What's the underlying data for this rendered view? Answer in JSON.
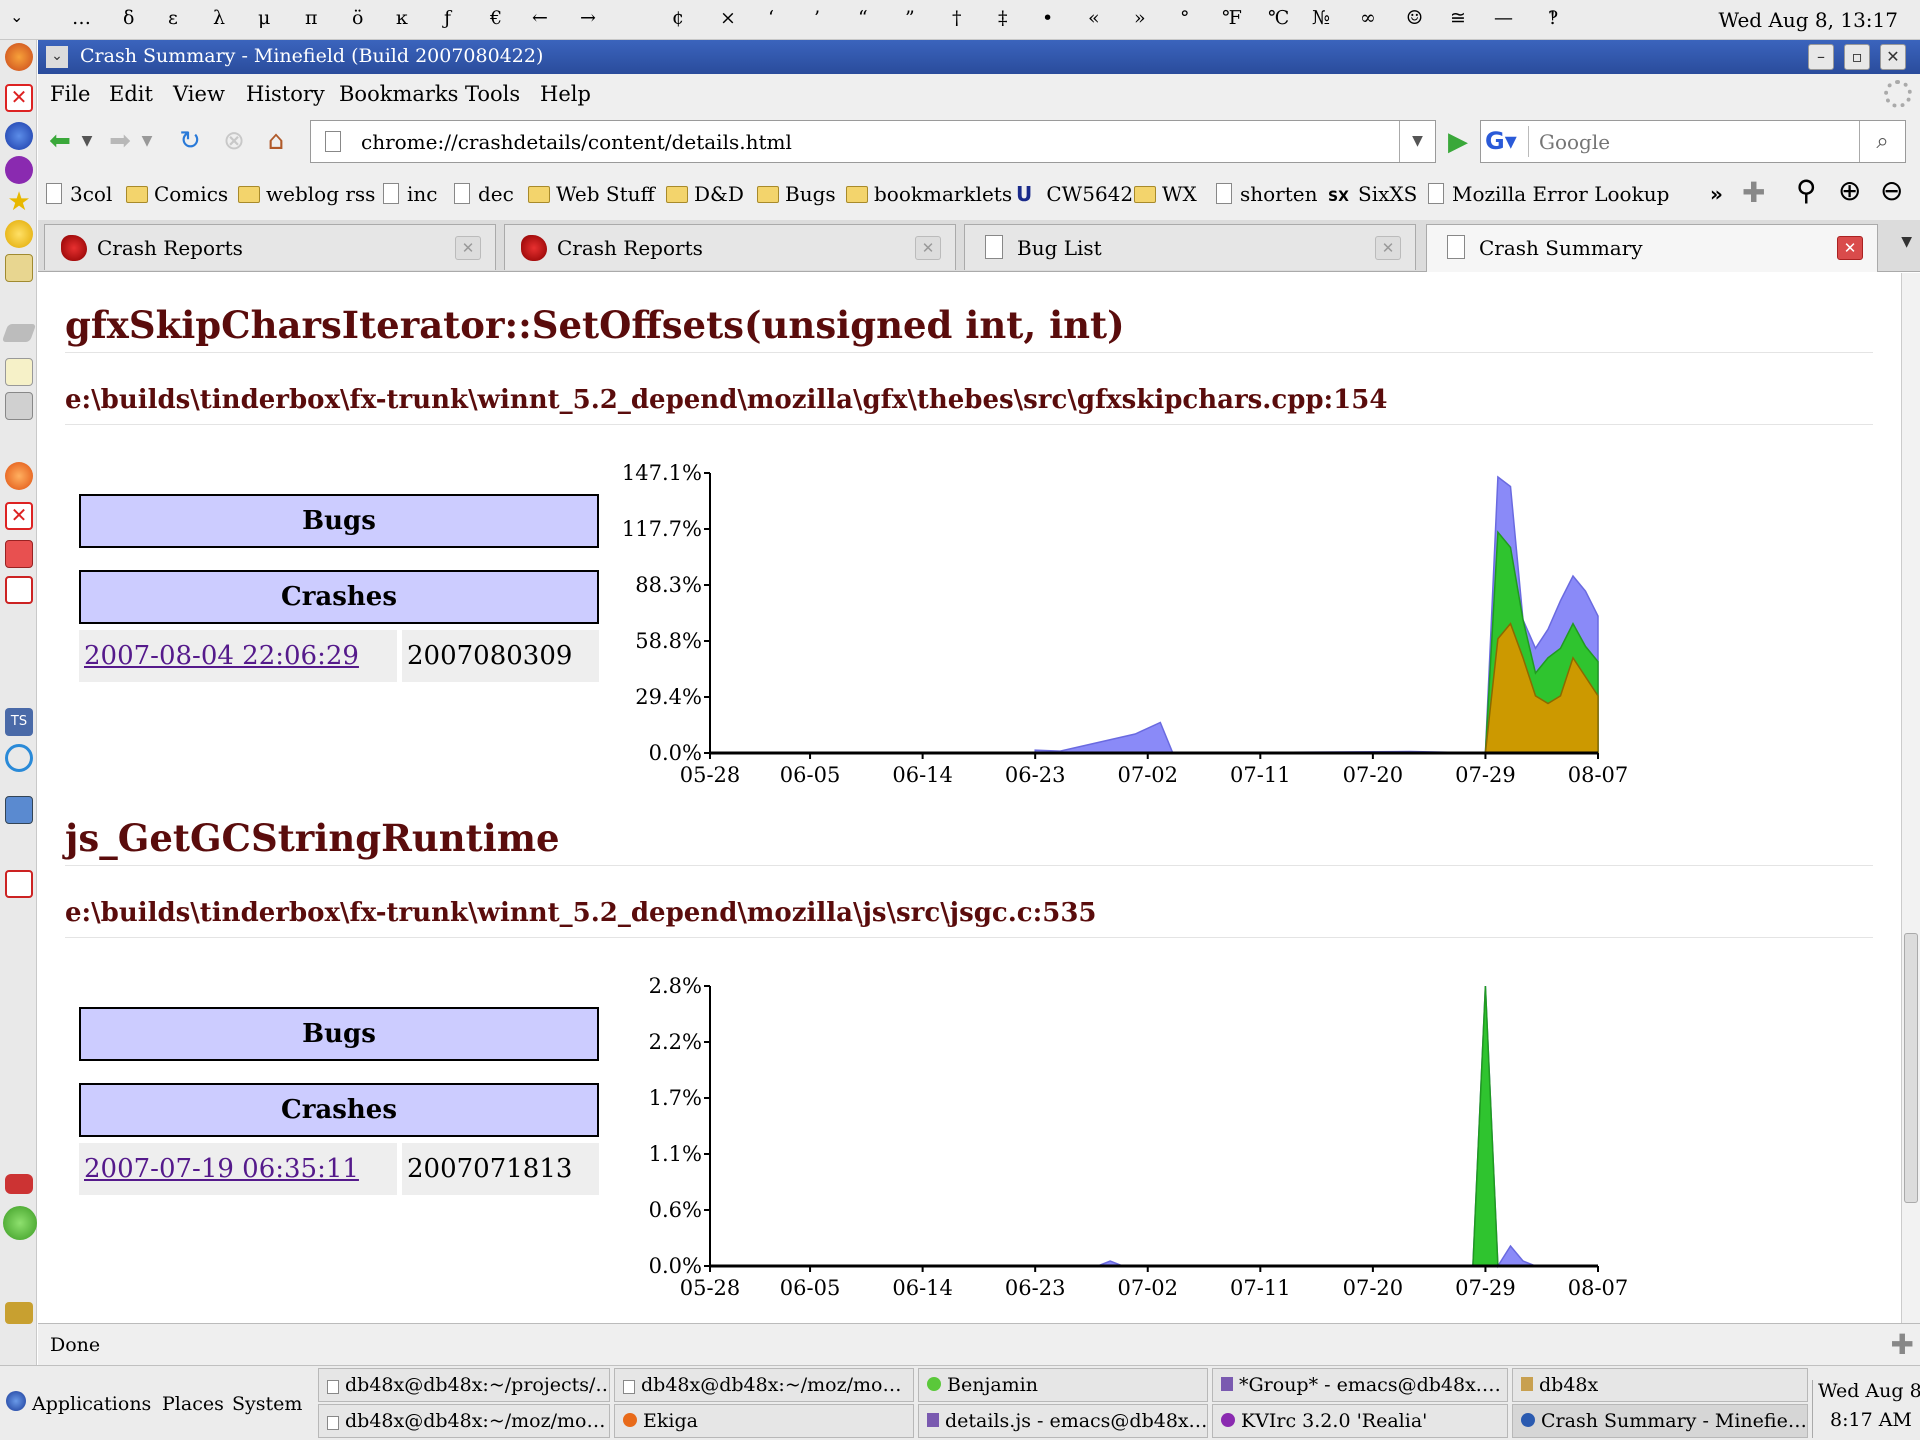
{
  "char_bar": {
    "glyphs": [
      "…",
      "δ",
      "ε",
      "λ",
      "μ",
      "π",
      "ö",
      "ĸ",
      "ƒ",
      "€",
      "←",
      "→",
      "¢",
      "×",
      "‘",
      "’",
      "“",
      "”",
      "†",
      "‡",
      "•",
      "«",
      "»",
      "°",
      "℉",
      "℃",
      "№",
      "∞",
      "☺",
      "≅",
      "—",
      "‽"
    ],
    "clock": "Wed Aug 8, 13:17"
  },
  "window": {
    "title": "Crash Summary - Minefield (Build 2007080422)"
  },
  "menu": [
    "File",
    "Edit",
    "View",
    "History",
    "Bookmarks",
    "Tools",
    "Help"
  ],
  "nav": {
    "url": "chrome://crashdetails/content/details.html",
    "search_placeholder": "Google"
  },
  "bookmarks": [
    {
      "label": "3col",
      "kind": "page"
    },
    {
      "label": "Comics",
      "kind": "folder"
    },
    {
      "label": "weblog rss",
      "kind": "folder"
    },
    {
      "label": "inc",
      "kind": "page"
    },
    {
      "label": "dec",
      "kind": "page"
    },
    {
      "label": "Web Stuff",
      "kind": "folder"
    },
    {
      "label": "D&D",
      "kind": "folder"
    },
    {
      "label": "Bugs",
      "kind": "folder"
    },
    {
      "label": "bookmarklets",
      "kind": "folder"
    },
    {
      "label": "CW5642",
      "kind": "u"
    },
    {
      "label": "WX",
      "kind": "folder"
    },
    {
      "label": "shorten",
      "kind": "page"
    },
    {
      "label": "SixXS",
      "kind": "sixxs"
    },
    {
      "label": "Mozilla Error Lookup",
      "kind": "page"
    }
  ],
  "tabs": [
    {
      "label": "Crash Reports",
      "selected": false
    },
    {
      "label": "Crash Reports",
      "selected": false
    },
    {
      "label": "Bug List",
      "selected": false
    },
    {
      "label": "Crash Summary",
      "selected": true
    }
  ],
  "sections": [
    {
      "function": "gfxSkipCharsIterator::SetOffsets(unsigned int, int)",
      "location": "e:\\builds\\tinderbox\\fx-trunk\\winnt_5.2_depend\\mozilla\\gfx\\thebes\\src\\gfxskipchars.cpp:154",
      "bugs_header": "Bugs",
      "crashes_header": "Crashes",
      "crashes": [
        {
          "date": "2007-08-04 22:06:29",
          "build": "2007080309"
        }
      ]
    },
    {
      "function": "js_GetGCStringRuntime",
      "location": "e:\\builds\\tinderbox\\fx-trunk\\winnt_5.2_depend\\mozilla\\js\\src\\jsgc.c:535",
      "bugs_header": "Bugs",
      "crashes_header": "Crashes",
      "crashes": [
        {
          "date": "2007-07-19 06:35:11",
          "build": "2007071813"
        }
      ]
    }
  ],
  "chart_data": [
    {
      "type": "area",
      "x_tick_labels": [
        "05-28",
        "06-05",
        "06-14",
        "06-23",
        "07-02",
        "07-11",
        "07-20",
        "07-29",
        "08-07"
      ],
      "y_tick_labels": [
        "0.0%",
        "29.4%",
        "58.8%",
        "88.3%",
        "117.7%",
        "147.1%"
      ],
      "x_range": [
        "05-28",
        "08-07"
      ],
      "ylim": [
        0,
        147.1
      ],
      "colors": {
        "series1": "#8a8af8",
        "series2": "#2fc42f",
        "series3": "#cc9900"
      },
      "x": [
        "06-23",
        "06-25",
        "07-01",
        "07-03",
        "07-04",
        "07-23",
        "07-29",
        "07-30",
        "07-31",
        "08-01",
        "08-02",
        "08-03",
        "08-04",
        "08-05",
        "08-06",
        "08-07"
      ],
      "series": [
        {
          "values": [
            1.5,
            1,
            10,
            16,
            0,
            0.8,
            0,
            145,
            140,
            70,
            55,
            65,
            80,
            93,
            85,
            72
          ]
        },
        {
          "values": [
            0,
            0,
            0,
            0,
            0,
            0,
            0,
            116,
            108,
            70,
            42,
            50,
            55,
            68,
            56,
            48
          ]
        },
        {
          "values": [
            0,
            0,
            0,
            0,
            0,
            0,
            0,
            60,
            68,
            50,
            30,
            26,
            30,
            50,
            40,
            30
          ]
        }
      ]
    },
    {
      "type": "area",
      "x_tick_labels": [
        "05-28",
        "06-05",
        "06-14",
        "06-23",
        "07-02",
        "07-11",
        "07-20",
        "07-29",
        "08-07"
      ],
      "y_tick_labels": [
        "0.0%",
        "0.6%",
        "1.1%",
        "1.7%",
        "2.2%",
        "2.8%"
      ],
      "x_range": [
        "05-28",
        "08-07"
      ],
      "ylim": [
        0,
        2.8
      ],
      "colors": {
        "series1": "#8a8af8",
        "series2": "#2fc42f",
        "series3": "#cc9900"
      },
      "x": [
        "06-28",
        "06-29",
        "06-30",
        "07-28",
        "07-29",
        "07-30",
        "07-31",
        "08-01",
        "08-02"
      ],
      "series": [
        {
          "values": [
            0,
            0.05,
            0,
            0,
            2.8,
            0,
            0.2,
            0.05,
            0
          ]
        },
        {
          "values": [
            0,
            0,
            0,
            0,
            2.8,
            0,
            0,
            0,
            0
          ]
        },
        {
          "values": [
            0,
            0,
            0,
            0,
            0,
            0,
            0,
            0,
            0
          ]
        }
      ]
    }
  ],
  "status": "Done",
  "panel": {
    "menus": [
      "Applications",
      "Places",
      "System"
    ],
    "tasks": [
      "db48x@db48x:~/projects/…",
      "db48x@db48x:~/moz/mo…",
      "Benjamin",
      "*Group* - emacs@db48x.…",
      "db48x",
      "db48x@db48x:~/moz/mo…",
      "Ekiga",
      "details.js - emacs@db48x.…",
      "KVIrc 3.2.0 'Realia'",
      "Crash Summary - Minefie…"
    ],
    "clock_date": "Wed Aug 8",
    "clock_time": "8:17 AM"
  }
}
